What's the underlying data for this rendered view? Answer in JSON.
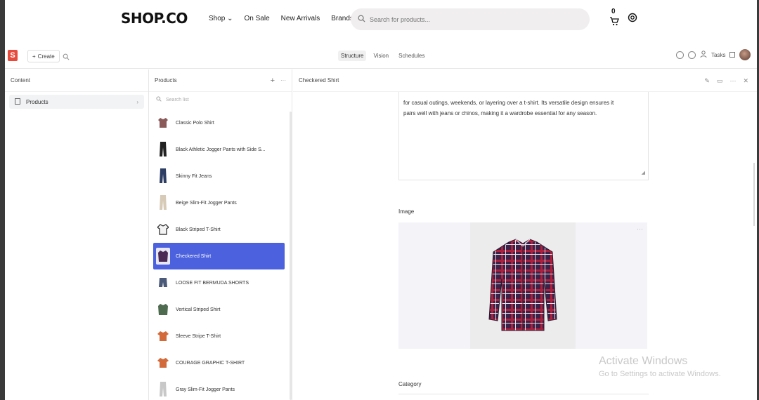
{
  "shop": {
    "brand": "SHOP.CO",
    "nav": [
      "Shop ⌄",
      "On Sale",
      "New Arrivals",
      "Brands"
    ],
    "search_placeholder": "Search for products...",
    "cart_count": "0"
  },
  "studio": {
    "create_label": "Create",
    "tabs": [
      "Structure",
      "Vision",
      "Schedules"
    ],
    "tasks_label": "Tasks"
  },
  "content_pane": {
    "title": "Content",
    "items": [
      {
        "label": "Products"
      }
    ]
  },
  "products_pane": {
    "title": "Products",
    "search_placeholder": "Search list",
    "items": [
      {
        "label": "Classic Polo Shirt",
        "thumb": "polo-shirt"
      },
      {
        "label": "Black Athletic Jogger Pants with Side S...",
        "thumb": "black-pants"
      },
      {
        "label": "Skinny Fit Jeans",
        "thumb": "jeans"
      },
      {
        "label": "Beige Slim-Fit Jogger Pants",
        "thumb": "beige-pants"
      },
      {
        "label": "Black Striped T-Shirt",
        "thumb": "striped-tshirt"
      },
      {
        "label": "Checkered Shirt",
        "thumb": "checkered-shirt",
        "selected": true
      },
      {
        "label": "LOOSE FIT BERMUDA SHORTS",
        "thumb": "shorts"
      },
      {
        "label": "Vertical Striped Shirt",
        "thumb": "green-shirt"
      },
      {
        "label": "Sleeve Stripe T-Shirt",
        "thumb": "orange-tshirt"
      },
      {
        "label": "COURAGE GRAPHIC T-SHIRT",
        "thumb": "orange-tshirt"
      },
      {
        "label": "Gray Slim-Fit Jogger Pants",
        "thumb": "gray-pants"
      }
    ]
  },
  "document": {
    "title": "Checkered Shirt",
    "description_lines": [
      "for casual outings, weekends, or layering over a t-shirt. Its versatile design ensures it",
      "pairs well with jeans or chinos, making it a wardrobe essential for any season."
    ],
    "image_label": "Image",
    "category_label": "Category"
  },
  "watermark": {
    "line1": "Activate Windows",
    "line2": "Go to Settings to activate Windows."
  },
  "colors": {
    "selected": "#4b61dd",
    "logo": "#e84b3c",
    "search_bg": "#f0eeee"
  }
}
